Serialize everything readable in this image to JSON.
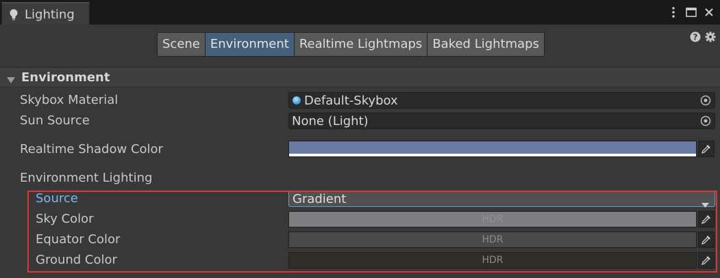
{
  "window": {
    "title": "Lighting",
    "icons": [
      "lightbulb-icon",
      "kebab-menu-icon",
      "maximize-icon",
      "close-icon"
    ]
  },
  "tabs": [
    {
      "label": "Scene",
      "active": false
    },
    {
      "label": "Environment",
      "active": true
    },
    {
      "label": "Realtime Lightmaps",
      "active": false
    },
    {
      "label": "Baked Lightmaps",
      "active": false
    }
  ],
  "section": {
    "title": "Environment"
  },
  "fields": {
    "skybox_material": {
      "label": "Skybox Material",
      "value": "Default-Skybox"
    },
    "sun_source": {
      "label": "Sun Source",
      "value": "None (Light)"
    },
    "realtime_shadow_color": {
      "label": "Realtime Shadow Color",
      "color": "#6a7ba3"
    }
  },
  "environment_lighting": {
    "label": "Environment Lighting",
    "source": {
      "label": "Source",
      "value": "Gradient"
    },
    "sky_color": {
      "label": "Sky Color",
      "color": "#7c7e82",
      "badge": "HDR"
    },
    "equator_color": {
      "label": "Equator Color",
      "color": "#4a4a4a",
      "badge": "HDR"
    },
    "ground_color": {
      "label": "Ground Color",
      "color": "#302c28",
      "badge": "HDR"
    }
  },
  "colors": {
    "active_tab": "#46607c",
    "highlight": "#e0343b",
    "label_accent": "#7ab7f5"
  }
}
